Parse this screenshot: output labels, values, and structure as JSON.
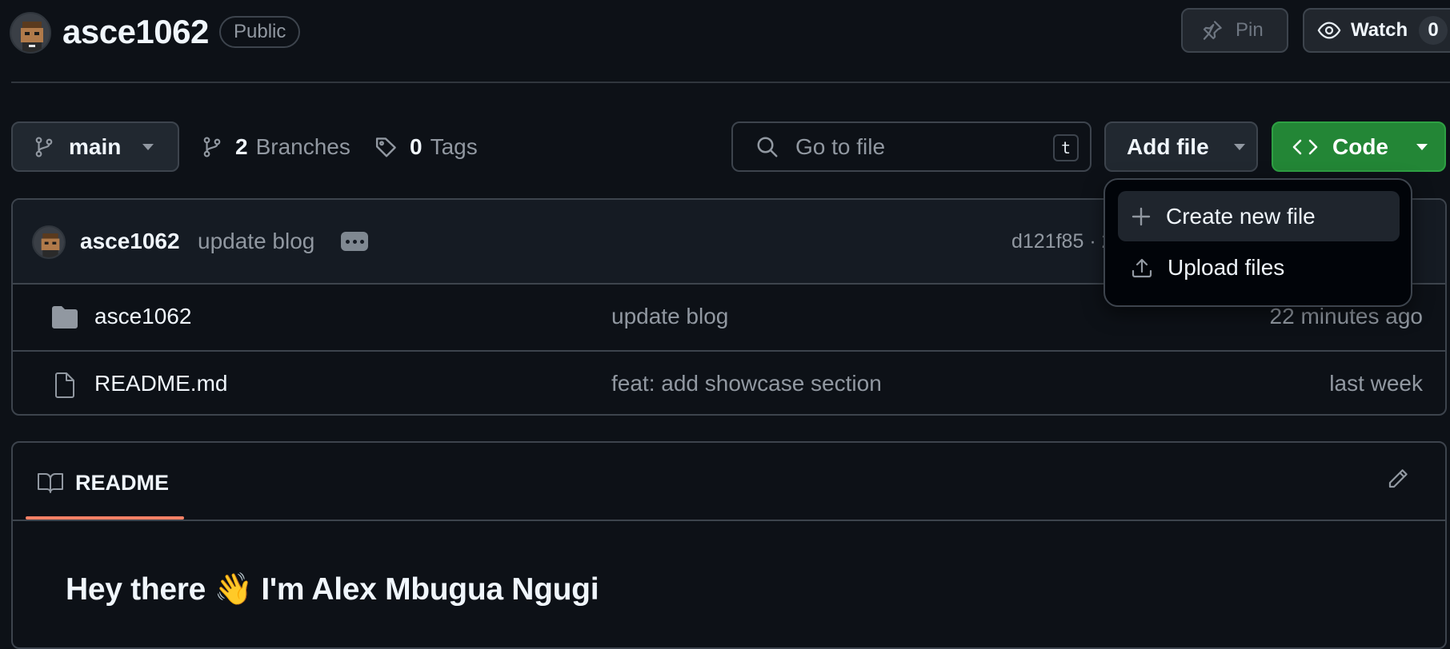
{
  "repo": {
    "name": "asce1062",
    "visibility": "Public"
  },
  "header": {
    "pin_label": "Pin",
    "watch_label": "Watch",
    "watch_count": "0"
  },
  "toolbar": {
    "branch": "main",
    "branches_count": "2",
    "branches_label": "Branches",
    "tags_count": "0",
    "tags_label": "Tags",
    "search_placeholder": "Go to file",
    "search_shortcut": "t",
    "add_file_label": "Add file",
    "code_label": "Code"
  },
  "add_file_menu": {
    "items": [
      {
        "label": "Create new file",
        "icon": "plus-icon"
      },
      {
        "label": "Upload files",
        "icon": "upload-icon"
      }
    ]
  },
  "latest_commit": {
    "author": "asce1062",
    "message": "update blog",
    "hash_partial": "d121f85 · 2"
  },
  "files": [
    {
      "name": "asce1062",
      "type": "folder",
      "message": "update blog",
      "time": "22 minutes ago"
    },
    {
      "name": "README.md",
      "type": "file",
      "message": "feat: add showcase section",
      "time": "last week"
    }
  ],
  "readme": {
    "tab_label": "README",
    "heading": "Hey there 👋 I'm Alex Mbugua Ngugi"
  },
  "colors": {
    "background": "#0d1117",
    "code_button": "#238636",
    "tab_accent": "#f78166"
  }
}
